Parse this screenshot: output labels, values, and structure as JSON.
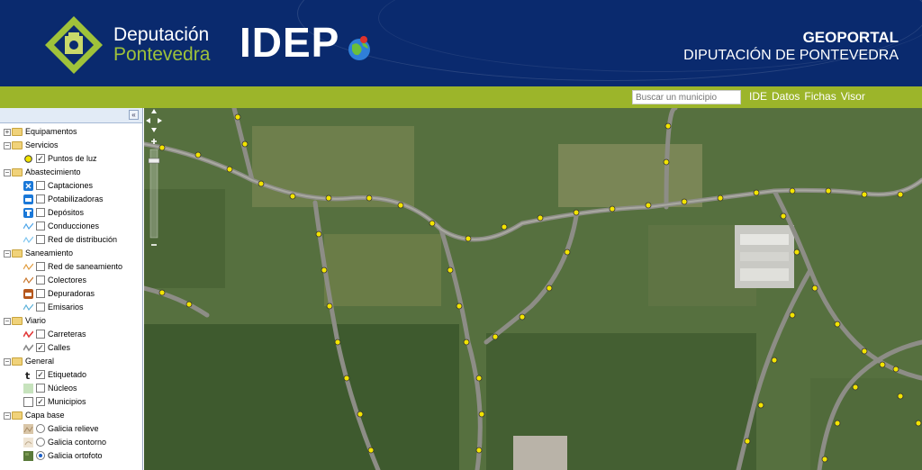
{
  "header": {
    "brand_line1": "Deputación",
    "brand_line2": "Pontevedra",
    "product": "IDEP",
    "portal_title": "GEOPORTAL",
    "portal_subtitle": "DIPUTACIÓN DE PONTEVEDRA"
  },
  "nav": {
    "search_placeholder": "Buscar un municipio",
    "links": [
      "IDE",
      "Datos",
      "Fichas",
      "Visor"
    ]
  },
  "sidebar": {
    "collapse_glyph": "«",
    "groups": [
      {
        "label": "Equipamentos",
        "expanded": false,
        "items": []
      },
      {
        "label": "Servicios",
        "expanded": true,
        "items": [
          {
            "label": "Puntos de luz",
            "checked": true,
            "icon": "yellow-dot-icon"
          }
        ]
      },
      {
        "label": "Abastecimiento",
        "expanded": true,
        "items": [
          {
            "label": "Captaciones",
            "checked": false,
            "icon": "water-tap-icon"
          },
          {
            "label": "Potabilizadoras",
            "checked": false,
            "icon": "water-plant-icon"
          },
          {
            "label": "Depósitos",
            "checked": false,
            "icon": "water-tank-icon"
          },
          {
            "label": "Conducciones",
            "checked": false,
            "icon": "pipe-line-icon"
          },
          {
            "label": "Red de distribución",
            "checked": false,
            "icon": "distribution-line-icon"
          }
        ]
      },
      {
        "label": "Saneamiento",
        "expanded": true,
        "items": [
          {
            "label": "Red de saneamiento",
            "checked": false,
            "icon": "sewer-line-icon"
          },
          {
            "label": "Colectores",
            "checked": false,
            "icon": "collector-line-icon"
          },
          {
            "label": "Depuradoras",
            "checked": false,
            "icon": "treatment-plant-icon"
          },
          {
            "label": "Emisarios",
            "checked": false,
            "icon": "outfall-line-icon"
          }
        ]
      },
      {
        "label": "Viario",
        "expanded": true,
        "items": [
          {
            "label": "Carreteras",
            "checked": false,
            "icon": "road-red-icon"
          },
          {
            "label": "Calles",
            "checked": true,
            "icon": "street-grey-icon"
          }
        ]
      },
      {
        "label": "General",
        "expanded": true,
        "items": [
          {
            "label": "Etiquetado",
            "checked": true,
            "icon": "text-label-icon"
          },
          {
            "label": "Núcleos",
            "checked": false,
            "icon": "nucleus-area-icon"
          },
          {
            "label": "Municipios",
            "checked": true,
            "icon": "municipality-area-icon"
          }
        ]
      },
      {
        "label": "Capa base",
        "expanded": true,
        "radio": true,
        "items": [
          {
            "label": "Galicia relieve",
            "selected": false,
            "icon": "relief-thumb-icon"
          },
          {
            "label": "Galicia contorno",
            "selected": false,
            "icon": "contour-thumb-icon"
          },
          {
            "label": "Galicia ortofoto",
            "selected": true,
            "icon": "orthophoto-thumb-icon"
          }
        ]
      }
    ]
  },
  "colors": {
    "header_bg": "#0a2a6e",
    "accent_green": "#9cb52a",
    "brand_green": "#9fc23a",
    "light_point": "#f2e400"
  }
}
